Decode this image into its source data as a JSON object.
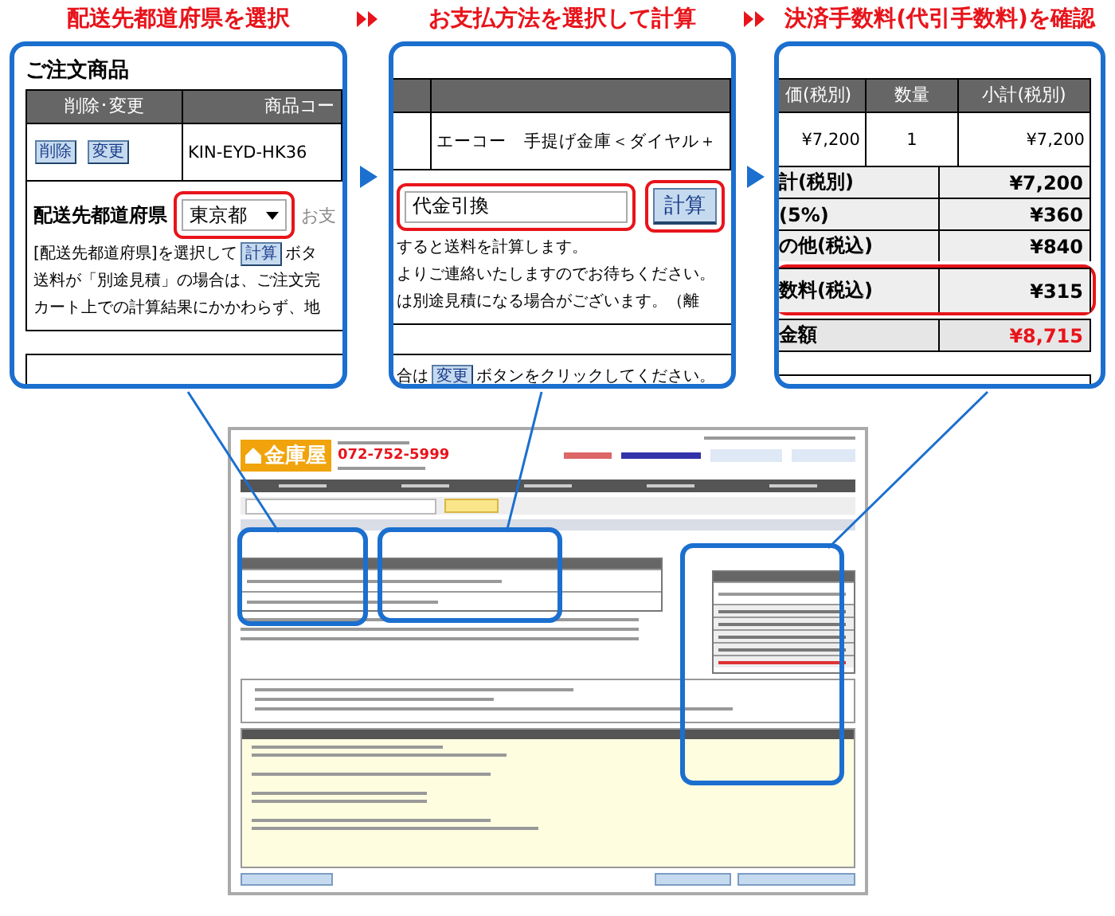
{
  "steps": [
    {
      "title": "配送先都道府県を選択"
    },
    {
      "title": "お支払方法を選択して計算"
    },
    {
      "title": "決済手数料(代引手数料)を確認"
    }
  ],
  "panel_1": {
    "section_title": "ご注文商品",
    "columns": [
      "削除･変更",
      "商品コー"
    ],
    "buttons": [
      "削除",
      "変更"
    ],
    "code": "KIN-EYD-HK36",
    "pref_label": "配送先都道府県",
    "pref_value": "東京都",
    "pref_next": "お支",
    "help_before": "[配送先都道府県]を選択して",
    "help_button": "計算",
    "help_after": "ボタ",
    "lines": [
      "送料が「別途見積」の場合は、ご注文完",
      "カート上での計算結果にかかわらず、地"
    ]
  },
  "panel_2": {
    "product": "エーコー　手提げ金庫＜ダイヤル＋",
    "payment": "代金引換",
    "calc_button": "計算",
    "lines": [
      "すると送料を計算します。",
      "よりご連絡いたしますのでお待ちください。",
      "は別途見積になる場合がございます。（離"
    ],
    "note_before": "合は",
    "note_button": "変更",
    "note_after": "ボタンをクリックしてください。"
  },
  "panel_3": {
    "columns": [
      "価(税別)",
      "数量",
      "小計(税別)"
    ],
    "row": [
      "¥7,200",
      "1",
      "¥7,200"
    ],
    "summary": [
      {
        "label": "計(税別)",
        "value": "¥7,200",
        "highlighted": false,
        "total": false
      },
      {
        "label": "(5%)",
        "value": "¥360",
        "highlighted": false,
        "total": false
      },
      {
        "label": "の他(税込)",
        "value": "¥840",
        "highlighted": false,
        "total": false
      },
      {
        "label": "数料(税込)",
        "value": "¥315",
        "highlighted": true,
        "total": false
      },
      {
        "label": "金額",
        "value": "¥8,715",
        "highlighted": false,
        "total": true
      }
    ]
  },
  "thumbnail": {
    "logo": "金庫屋",
    "phone": "072-752-5999"
  }
}
